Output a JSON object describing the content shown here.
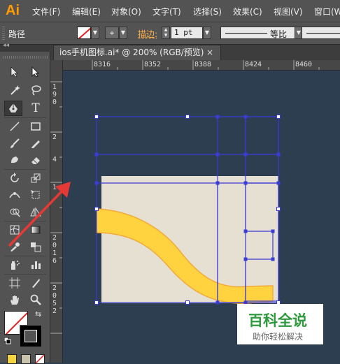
{
  "app": {
    "logo": "Ai"
  },
  "menu": [
    {
      "label": "文件(F)"
    },
    {
      "label": "编辑(E)"
    },
    {
      "label": "对象(O)"
    },
    {
      "label": "文字(T)"
    },
    {
      "label": "选择(S)"
    },
    {
      "label": "效果(C)"
    },
    {
      "label": "视图(V)"
    },
    {
      "label": "窗口(W"
    }
  ],
  "control_bar": {
    "selection_type": "路径",
    "stroke_label": "描边:",
    "stroke_weight": "1 pt",
    "stroke_profile": "等比"
  },
  "document": {
    "tab_title": "ios手机图标.ai* @ 200% (RGB/预览)",
    "close_glyph": "×"
  },
  "rulers": {
    "top": [
      "8316",
      "8352",
      "8388",
      "8424",
      "8460"
    ],
    "left": [
      "190",
      "2",
      "4",
      "1",
      "2016",
      "2052"
    ]
  },
  "tools": [
    {
      "icon": "selection-tool-icon"
    },
    {
      "icon": "direct-selection-tool-icon"
    },
    {
      "icon": "magic-wand-tool-icon"
    },
    {
      "icon": "lasso-tool-icon"
    },
    {
      "icon": "pen-tool-icon",
      "active": true
    },
    {
      "icon": "type-tool-icon"
    },
    {
      "icon": "line-segment-tool-icon"
    },
    {
      "icon": "rectangle-tool-icon"
    },
    {
      "icon": "paintbrush-tool-icon"
    },
    {
      "icon": "pencil-tool-icon"
    },
    {
      "icon": "blob-brush-tool-icon"
    },
    {
      "icon": "eraser-tool-icon"
    },
    {
      "icon": "rotate-tool-icon"
    },
    {
      "icon": "scale-tool-icon"
    },
    {
      "icon": "width-tool-icon"
    },
    {
      "icon": "free-transform-tool-icon"
    },
    {
      "icon": "shape-builder-tool-icon"
    },
    {
      "icon": "perspective-grid-tool-icon"
    },
    {
      "icon": "mesh-tool-icon"
    },
    {
      "icon": "gradient-tool-icon"
    },
    {
      "icon": "eyedropper-tool-icon"
    },
    {
      "icon": "blend-tool-icon"
    },
    {
      "icon": "symbol-sprayer-tool-icon"
    },
    {
      "icon": "column-graph-tool-icon"
    },
    {
      "icon": "artboard-tool-icon"
    },
    {
      "icon": "slice-tool-icon"
    },
    {
      "icon": "hand-tool-icon"
    },
    {
      "icon": "zoom-tool-icon"
    }
  ],
  "colors": {
    "chrome": "#535353",
    "canvas": "#2c3e50",
    "selection": "#3b3bd6",
    "card": "#e5e0d2",
    "wave": "#ffd23f",
    "wave_edge": "#f2a93b",
    "annotation_arrow": "#e53935",
    "watermark_green": "#2f9a3e"
  },
  "watermark": {
    "title": "百科全说",
    "subtitle": "助你轻松解决"
  }
}
